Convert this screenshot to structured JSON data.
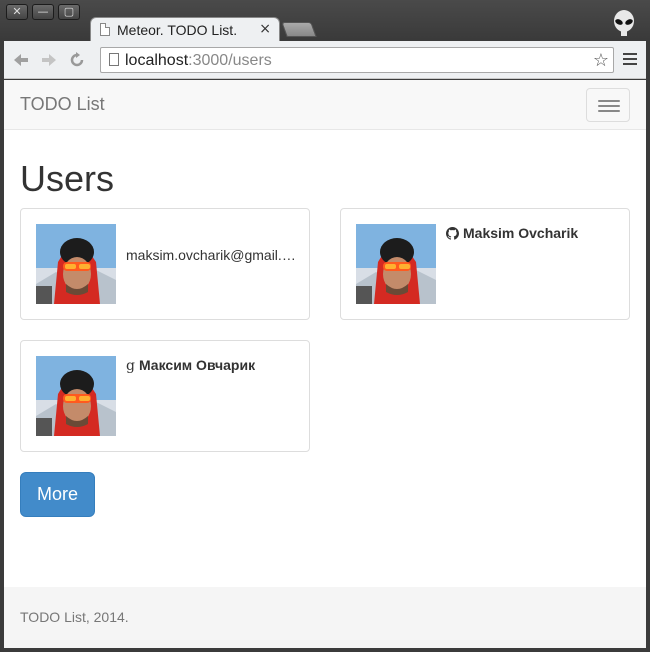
{
  "browser": {
    "tab_title": "Meteor. TODO List.",
    "tab_close": "×",
    "url_host": "localhost",
    "url_rest": ":3000/users",
    "window_buttons": {
      "close": "✕",
      "minimize": "—",
      "maximize": "▢"
    },
    "icons": {
      "back": "arrow-left-icon",
      "forward": "arrow-right-icon",
      "reload": "reload-icon",
      "bookmark": "star-icon",
      "menu": "hamburger-menu-icon",
      "profile": "alien-avatar-icon"
    }
  },
  "navbar": {
    "brand": "TODO List"
  },
  "page": {
    "title": "Users"
  },
  "users": [
    {
      "name": "",
      "email": "maksim.ovcharik@gmail.com",
      "service": "",
      "service_icon": ""
    },
    {
      "name": "Maksim Ovcharik",
      "email": "",
      "service": "github",
      "service_icon": "github-icon"
    },
    {
      "name": "Максим Овчарик",
      "email": "",
      "service": "google",
      "service_icon": "google-icon"
    }
  ],
  "more_button": "More",
  "footer": {
    "text": "TODO List, 2014."
  },
  "colors": {
    "primary": "#428bca",
    "navbar_bg": "#f8f8f8",
    "footer_bg": "#f5f5f5"
  }
}
